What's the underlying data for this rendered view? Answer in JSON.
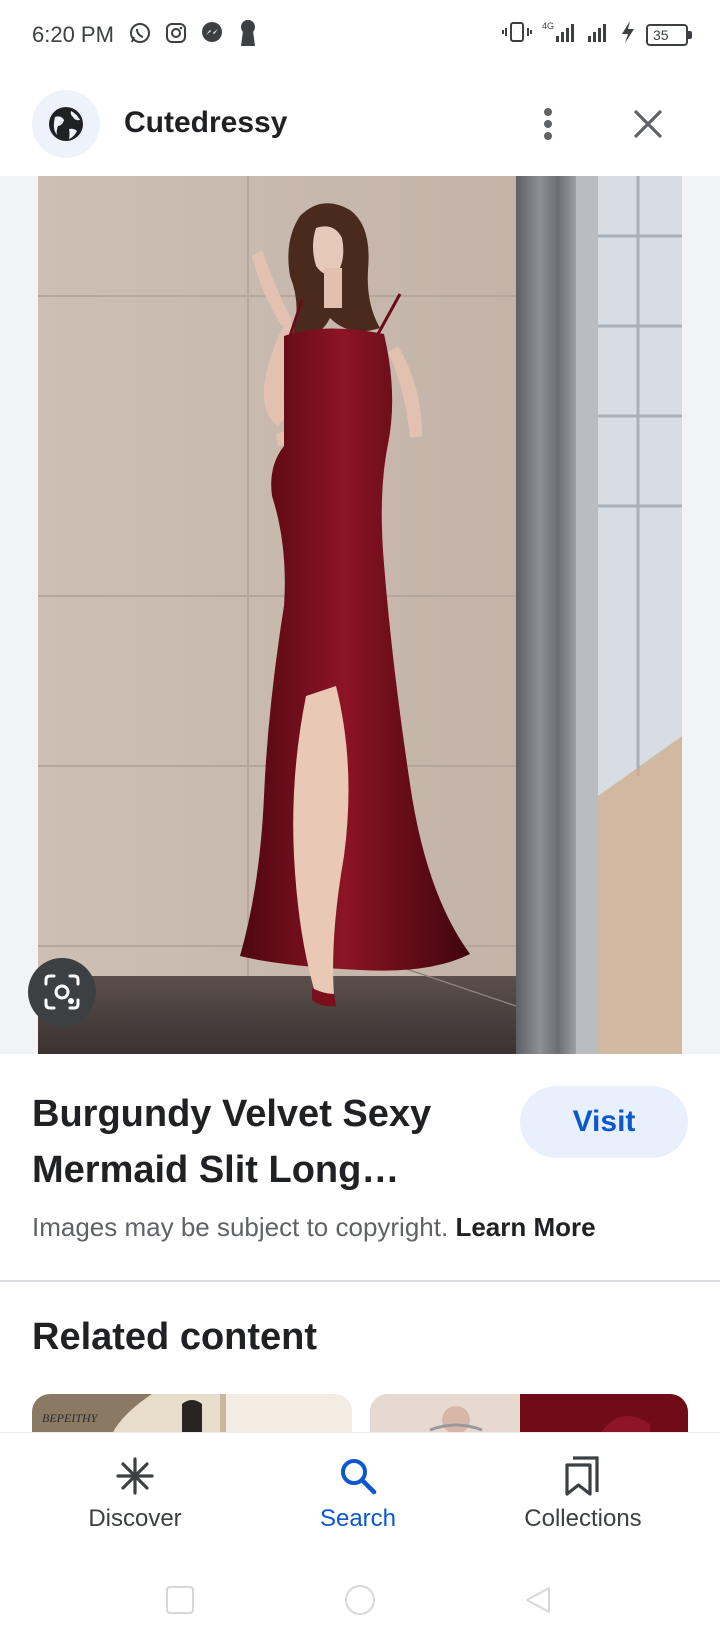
{
  "status_bar": {
    "time": "6:20 PM",
    "battery": "35",
    "network": "4G",
    "left_icons": [
      "whatsapp-icon",
      "instagram-icon",
      "messenger-icon",
      "keyhole-icon"
    ],
    "right_icons": [
      "vibrate-icon",
      "signal-4g-icon",
      "signal-icon",
      "charging-icon",
      "battery-icon"
    ]
  },
  "header": {
    "site_name": "Cutedressy",
    "site_icon": "globe-icon",
    "more_icon": "more-vert-icon",
    "close_icon": "close-icon"
  },
  "viewer": {
    "lens_icon": "lens-search-icon",
    "image_subject": "burgundy velvet mermaid slit dress"
  },
  "result": {
    "title": "Burgundy Velvet Sexy Mermaid Slit Long…",
    "visit_label": "Visit",
    "copyright_text": "Images may be subject to copyright.",
    "learn_more_label": "Learn More"
  },
  "related": {
    "heading": "Related content",
    "thumb_1_text": "BEPEITHY"
  },
  "bottom_nav": {
    "items": [
      {
        "label": "Discover",
        "icon": "asterisk-icon",
        "active": false
      },
      {
        "label": "Search",
        "icon": "search-icon",
        "active": true
      },
      {
        "label": "Collections",
        "icon": "bookmarks-icon",
        "active": false
      }
    ]
  },
  "colors": {
    "accent": "#0b57d0",
    "visit_bg": "#e8f0fe",
    "text_primary": "#202124",
    "text_secondary": "#5f6368",
    "dress": "#7a0f1d"
  }
}
